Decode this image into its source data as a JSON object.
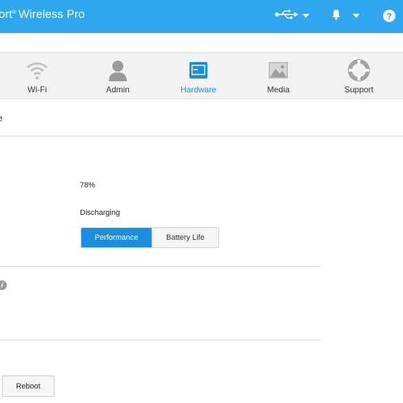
{
  "header": {
    "brand_fragment": "ort",
    "brand_reg": "®",
    "brand_rest": "Wireless Pro",
    "usb_icon": "usb-icon",
    "bell_icon": "bell-icon",
    "help_glyph": "?"
  },
  "nav": {
    "items": [
      {
        "label": "Wi-Fi",
        "icon": "wifi-icon"
      },
      {
        "label": "Admin",
        "icon": "user-icon"
      },
      {
        "label": "Hardware",
        "icon": "hardware-icon",
        "active": true
      },
      {
        "label": "Media",
        "icon": "image-icon"
      },
      {
        "label": "Support",
        "icon": "lifebuoy-icon"
      }
    ],
    "active_color": "#1a8ee0"
  },
  "section": {
    "title_fragment": "e"
  },
  "battery": {
    "percent_text": "78%",
    "status_text": "Discharging",
    "mode_options": [
      "Performance",
      "Battery Life"
    ],
    "selected_mode": "Performance"
  },
  "info": {
    "glyph": "i"
  },
  "actions": {
    "reboot_label": "Reboot"
  },
  "colors": {
    "header": "#2ea7f0",
    "accent": "#1a8ee0"
  }
}
